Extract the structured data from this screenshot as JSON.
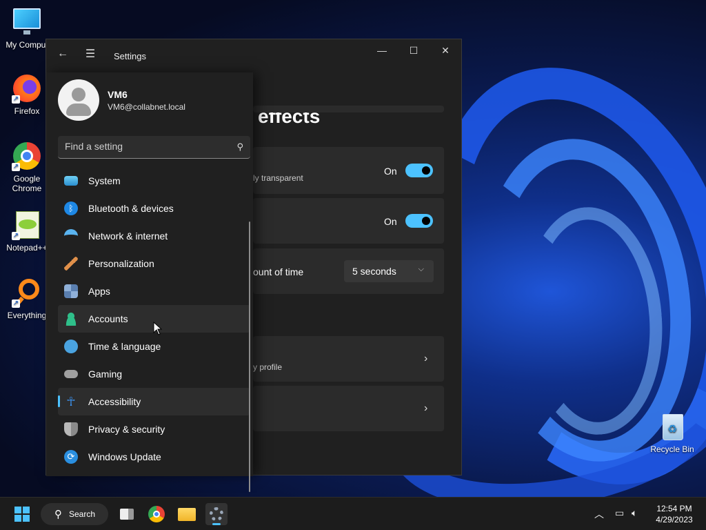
{
  "desktop": {
    "icons": [
      {
        "label": "My Comput"
      },
      {
        "label": "Firefox"
      },
      {
        "label": "Google Chrome"
      },
      {
        "label": "Notepad++"
      },
      {
        "label": "Everything"
      },
      {
        "label": "Recycle Bin"
      }
    ]
  },
  "window": {
    "title": "Settings",
    "controls": {
      "minimize": "—",
      "maximize": "☐",
      "close": "✕"
    }
  },
  "profile": {
    "name": "VM6",
    "email": "VM6@collabnet.local"
  },
  "search": {
    "placeholder": "Find a setting"
  },
  "nav": {
    "items": [
      {
        "label": "System",
        "icon": "system-icon",
        "color": "#3ea8e0"
      },
      {
        "label": "Bluetooth & devices",
        "icon": "bluetooth-icon",
        "color": "#1e88e5"
      },
      {
        "label": "Network & internet",
        "icon": "wifi-icon",
        "color": "#5ab4f0"
      },
      {
        "label": "Personalization",
        "icon": "brush-icon",
        "color": "#e0904a"
      },
      {
        "label": "Apps",
        "icon": "apps-icon",
        "color": "#7a95b8"
      },
      {
        "label": "Accounts",
        "icon": "accounts-icon",
        "color": "#2fbf8a"
      },
      {
        "label": "Time & language",
        "icon": "globe-clock-icon",
        "color": "#4aa3e0"
      },
      {
        "label": "Gaming",
        "icon": "gamepad-icon",
        "color": "#a0a0a0"
      },
      {
        "label": "Accessibility",
        "icon": "accessibility-icon",
        "color": "#3b8fe8"
      },
      {
        "label": "Privacy & security",
        "icon": "shield-icon",
        "color": "#9a9a9a"
      },
      {
        "label": "Windows Update",
        "icon": "update-icon",
        "color": "#2a8fe0"
      }
    ],
    "hovered": "Accounts",
    "active": "Accessibility"
  },
  "page": {
    "title": "effects",
    "transparency": {
      "desc": "ly transparent",
      "state": "On"
    },
    "animation": {
      "state": "On"
    },
    "dismiss": {
      "label": "ount of time",
      "value": "5 seconds"
    },
    "link1": {
      "desc": "y profile"
    }
  },
  "taskbar": {
    "search_label": "Search",
    "time": "12:54 PM",
    "date": "4/29/2023"
  }
}
